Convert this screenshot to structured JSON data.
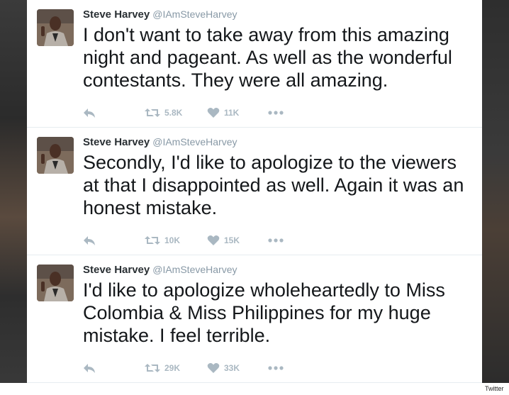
{
  "tweets": [
    {
      "name": "Steve Harvey",
      "handle": "@IAmSteveHarvey",
      "text": "I don't want to take away from this amazing night and pageant. As well as the wonderful contestants. They were all amazing.",
      "retweets": "5.8K",
      "likes": "11K"
    },
    {
      "name": "Steve Harvey",
      "handle": "@IAmSteveHarvey",
      "text": "Secondly, I'd like to apologize to the viewers at that I disappointed as well. Again it was an honest mistake.",
      "retweets": "10K",
      "likes": "15K"
    },
    {
      "name": "Steve Harvey",
      "handle": "@IAmSteveHarvey",
      "text": "I'd like to apologize wholeheartedly to Miss Colombia & Miss Philippines for my huge mistake. I feel terrible.",
      "retweets": "29K",
      "likes": "33K"
    }
  ],
  "icons": {
    "reply": "reply-icon",
    "retweet": "retweet-icon",
    "like": "heart-icon",
    "more": "more-icon"
  },
  "colors": {
    "name": "#292f33",
    "handle": "#8899a6",
    "text": "#14171a",
    "action": "#aab8c2"
  },
  "credit": "Twitter"
}
